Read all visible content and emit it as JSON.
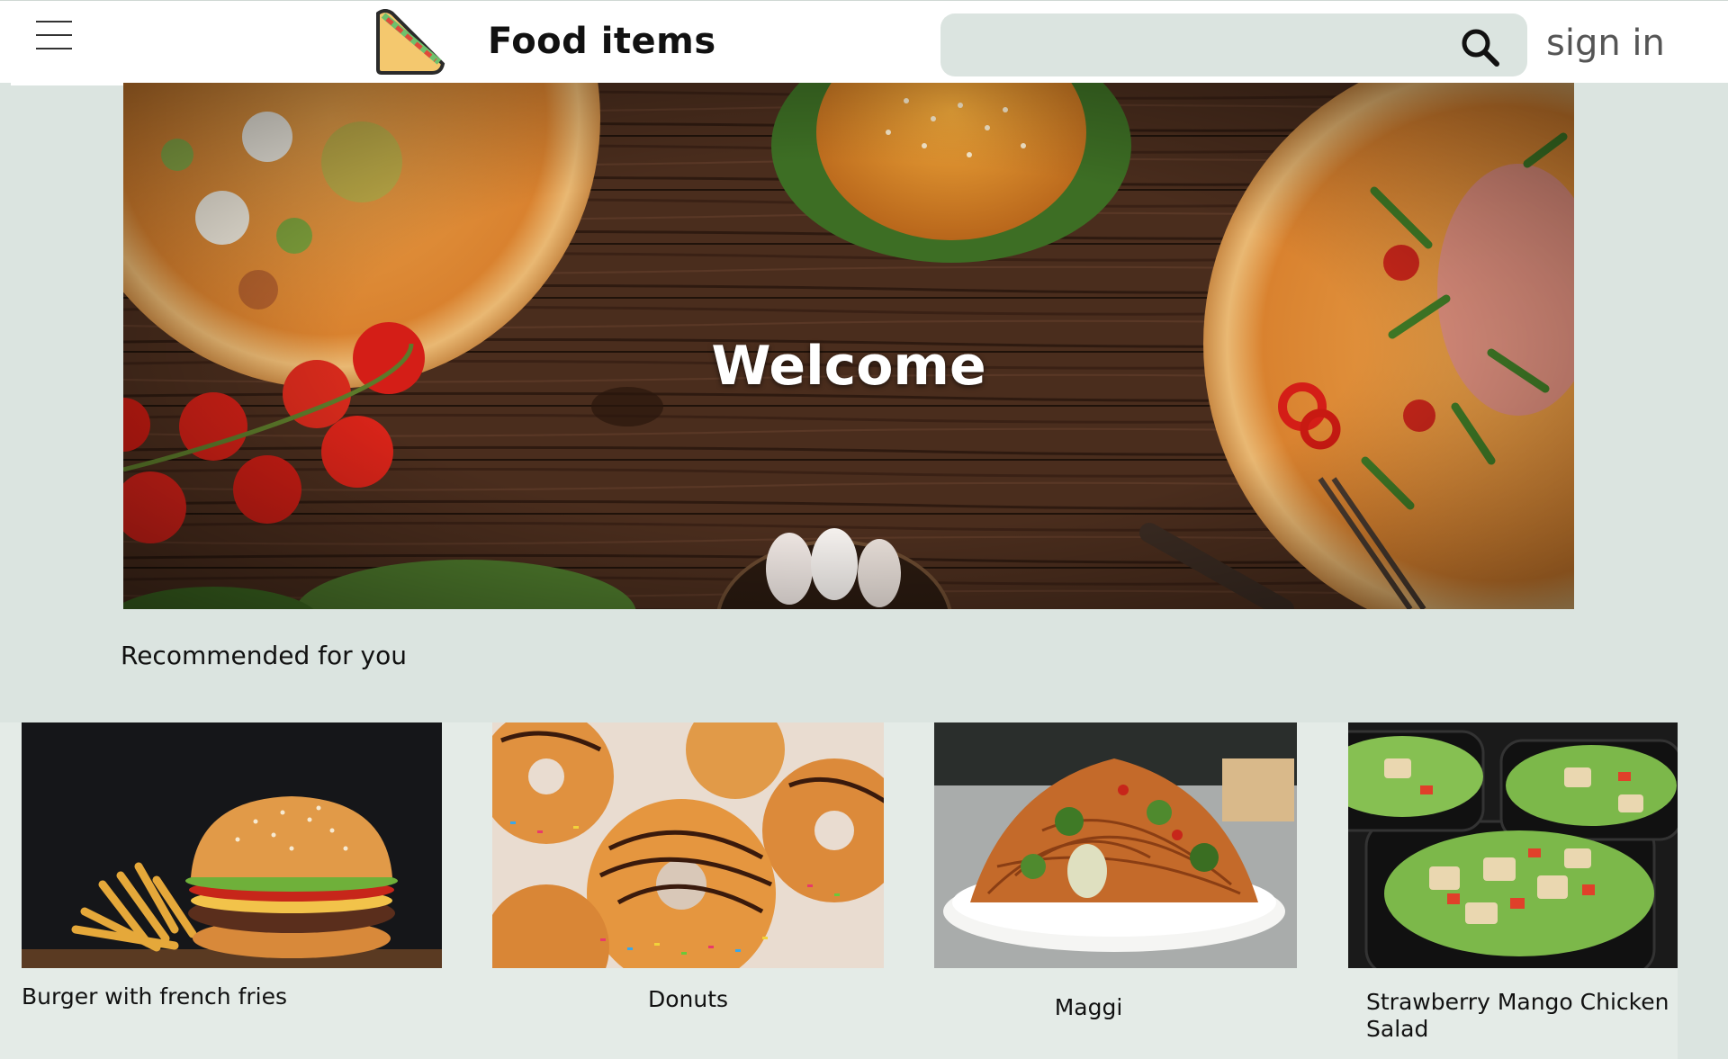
{
  "header": {
    "app_title": "Food items",
    "search_placeholder": "",
    "sign_in_label": "sign in"
  },
  "hero": {
    "title": "Welcome"
  },
  "recommended": {
    "title": "Recommended for you",
    "items": [
      {
        "label": "Burger with french fries"
      },
      {
        "label": "Donuts"
      },
      {
        "label": "Maggi"
      },
      {
        "label": "Strawberry Mango Chicken Salad"
      }
    ]
  },
  "colors": {
    "page_bg": "#dbe4e0",
    "header_bg": "#ffffff",
    "search_bg": "#dbe4e0",
    "sign_in_text": "#555555"
  },
  "icons": {
    "menu": "hamburger-menu-icon",
    "logo": "sandwich-logo-icon",
    "search": "magnifier-search-icon"
  }
}
